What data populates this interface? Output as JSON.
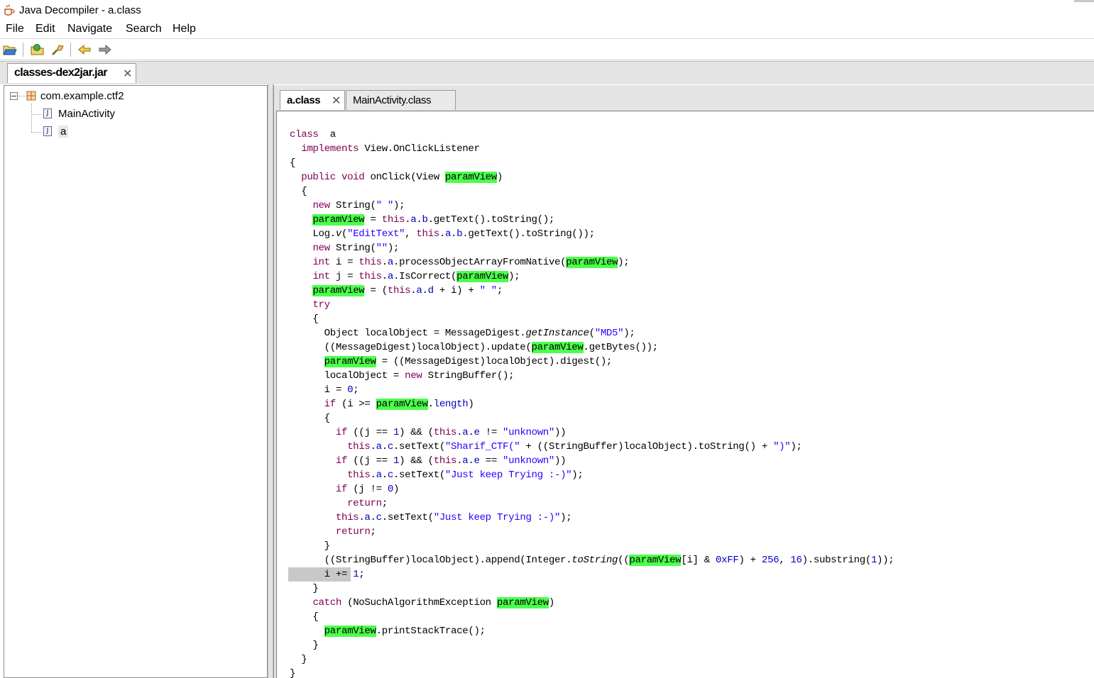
{
  "window": {
    "title": "Java Decompiler - a.class"
  },
  "menu": {
    "items": [
      "File",
      "Edit",
      "Navigate",
      "Search",
      "Help"
    ]
  },
  "toolbar": {
    "buttons": [
      "open-file-icon",
      "open-type-icon",
      "find-icon",
      "back-icon",
      "forward-icon"
    ]
  },
  "outer_tab": {
    "label": "classes-dex2jar.jar",
    "close": "✕"
  },
  "tree": {
    "package": "com.example.ctf2",
    "classes": [
      "MainActivity",
      "a"
    ],
    "selected": "a"
  },
  "inner_tabs": [
    {
      "label": "a.class",
      "close": "✕",
      "active": true
    },
    {
      "label": "MainActivity.class",
      "active": false
    }
  ],
  "colors": {
    "keyword": "#7f0055",
    "string": "#2a00ff",
    "field": "#0000c0",
    "highlight": "#4cff4c",
    "caret_line": "#c8c8c8"
  },
  "code_lines": [
    [
      [
        "kw",
        "class"
      ],
      [
        "",
        "  a"
      ]
    ],
    [
      [
        "",
        "  "
      ],
      [
        "kw",
        "implements"
      ],
      [
        "",
        " View.OnClickListener"
      ]
    ],
    [
      [
        "",
        "{"
      ]
    ],
    [
      [
        "",
        "  "
      ],
      [
        "kw",
        "public void"
      ],
      [
        "",
        " onClick(View "
      ],
      [
        "hv",
        "paramView"
      ],
      [
        "",
        ")"
      ]
    ],
    [
      [
        "",
        "  {"
      ]
    ],
    [
      [
        "",
        "    "
      ],
      [
        "kw",
        "new"
      ],
      [
        "",
        " String("
      ],
      [
        "str",
        "\" \""
      ],
      [
        "",
        ");"
      ]
    ],
    [
      [
        "",
        "    "
      ],
      [
        "hv",
        "paramView"
      ],
      [
        "",
        " = "
      ],
      [
        "kw",
        "this"
      ],
      [
        "",
        "."
      ],
      [
        "fld",
        "a"
      ],
      [
        "",
        "."
      ],
      [
        "fld",
        "b"
      ],
      [
        "",
        ".getText().toString();"
      ]
    ],
    [
      [
        "",
        "    Log."
      ],
      [
        "it",
        "v"
      ],
      [
        "",
        "("
      ],
      [
        "str",
        "\"EditText\""
      ],
      [
        "",
        ", "
      ],
      [
        "kw",
        "this"
      ],
      [
        "",
        "."
      ],
      [
        "fld",
        "a"
      ],
      [
        "",
        "."
      ],
      [
        "fld",
        "b"
      ],
      [
        "",
        ".getText().toString());"
      ]
    ],
    [
      [
        "",
        "    "
      ],
      [
        "kw",
        "new"
      ],
      [
        "",
        " String("
      ],
      [
        "str",
        "\"\""
      ],
      [
        "",
        ");"
      ]
    ],
    [
      [
        "",
        "    "
      ],
      [
        "kw",
        "int"
      ],
      [
        "",
        " i = "
      ],
      [
        "kw",
        "this"
      ],
      [
        "",
        "."
      ],
      [
        "fld",
        "a"
      ],
      [
        "",
        ".processObjectArrayFromNative("
      ],
      [
        "hv",
        "paramView"
      ],
      [
        "",
        ");"
      ]
    ],
    [
      [
        "",
        "    "
      ],
      [
        "kw",
        "int"
      ],
      [
        "",
        " j = "
      ],
      [
        "kw",
        "this"
      ],
      [
        "",
        "."
      ],
      [
        "fld",
        "a"
      ],
      [
        "",
        ".IsCorrect("
      ],
      [
        "hv",
        "paramView"
      ],
      [
        "",
        ");"
      ]
    ],
    [
      [
        "",
        "    "
      ],
      [
        "hv",
        "paramView"
      ],
      [
        "",
        " = ("
      ],
      [
        "kw",
        "this"
      ],
      [
        "",
        "."
      ],
      [
        "fld",
        "a"
      ],
      [
        "",
        "."
      ],
      [
        "fld",
        "d"
      ],
      [
        "",
        " + i) + "
      ],
      [
        "str",
        "\" \""
      ],
      [
        "",
        ";"
      ]
    ],
    [
      [
        "",
        "    "
      ],
      [
        "kw",
        "try"
      ]
    ],
    [
      [
        "",
        "    {"
      ]
    ],
    [
      [
        "",
        "      Object localObject = MessageDigest."
      ],
      [
        "it",
        "getInstance"
      ],
      [
        "",
        "("
      ],
      [
        "str",
        "\"MD5\""
      ],
      [
        "",
        ");"
      ]
    ],
    [
      [
        "",
        "      ((MessageDigest)localObject).update("
      ],
      [
        "hv",
        "paramView"
      ],
      [
        "",
        ".getBytes());"
      ]
    ],
    [
      [
        "",
        "      "
      ],
      [
        "hv",
        "paramView"
      ],
      [
        "",
        " = ((MessageDigest)localObject).digest();"
      ]
    ],
    [
      [
        "",
        "      localObject = "
      ],
      [
        "kw",
        "new"
      ],
      [
        "",
        " StringBuffer();"
      ]
    ],
    [
      [
        "",
        "      i = "
      ],
      [
        "num",
        "0"
      ],
      [
        "",
        ";"
      ]
    ],
    [
      [
        "",
        "      "
      ],
      [
        "kw",
        "if"
      ],
      [
        "",
        " (i >= "
      ],
      [
        "hv",
        "paramView"
      ],
      [
        "",
        "."
      ],
      [
        "fld",
        "length"
      ],
      [
        "",
        ")"
      ]
    ],
    [
      [
        "",
        "      {"
      ]
    ],
    [
      [
        "",
        "        "
      ],
      [
        "kw",
        "if"
      ],
      [
        "",
        " ((j == "
      ],
      [
        "num",
        "1"
      ],
      [
        "",
        ") && ("
      ],
      [
        "kw",
        "this"
      ],
      [
        "",
        "."
      ],
      [
        "fld",
        "a"
      ],
      [
        "",
        "."
      ],
      [
        "fld",
        "e"
      ],
      [
        "",
        " != "
      ],
      [
        "str",
        "\"unknown\""
      ],
      [
        "",
        "))"
      ]
    ],
    [
      [
        "",
        "          "
      ],
      [
        "kw",
        "this"
      ],
      [
        "",
        "."
      ],
      [
        "fld",
        "a"
      ],
      [
        "",
        "."
      ],
      [
        "fld",
        "c"
      ],
      [
        "",
        ".setText("
      ],
      [
        "str",
        "\"Sharif_CTF(\""
      ],
      [
        "",
        " + ((StringBuffer)localObject).toString() + "
      ],
      [
        "str",
        "\")\""
      ],
      [
        "",
        ");"
      ]
    ],
    [
      [
        "",
        "        "
      ],
      [
        "kw",
        "if"
      ],
      [
        "",
        " ((j == "
      ],
      [
        "num",
        "1"
      ],
      [
        "",
        ") && ("
      ],
      [
        "kw",
        "this"
      ],
      [
        "",
        "."
      ],
      [
        "fld",
        "a"
      ],
      [
        "",
        "."
      ],
      [
        "fld",
        "e"
      ],
      [
        "",
        " == "
      ],
      [
        "str",
        "\"unknown\""
      ],
      [
        "",
        "))"
      ]
    ],
    [
      [
        "",
        "          "
      ],
      [
        "kw",
        "this"
      ],
      [
        "",
        "."
      ],
      [
        "fld",
        "a"
      ],
      [
        "",
        "."
      ],
      [
        "fld",
        "c"
      ],
      [
        "",
        ".setText("
      ],
      [
        "str",
        "\"Just keep Trying :-)\""
      ],
      [
        "",
        ");"
      ]
    ],
    [
      [
        "",
        "        "
      ],
      [
        "kw",
        "if"
      ],
      [
        "",
        " (j != "
      ],
      [
        "num",
        "0"
      ],
      [
        "",
        ")"
      ]
    ],
    [
      [
        "",
        "          "
      ],
      [
        "kw",
        "return"
      ],
      [
        "",
        ";"
      ]
    ],
    [
      [
        "",
        "        "
      ],
      [
        "kw",
        "this"
      ],
      [
        "",
        "."
      ],
      [
        "fld",
        "a"
      ],
      [
        "",
        "."
      ],
      [
        "fld",
        "c"
      ],
      [
        "",
        ".setText("
      ],
      [
        "str",
        "\"Just keep Trying :-)\""
      ],
      [
        "",
        ");"
      ]
    ],
    [
      [
        "",
        "        "
      ],
      [
        "kw",
        "return"
      ],
      [
        "",
        ";"
      ]
    ],
    [
      [
        "",
        "      }"
      ]
    ],
    [
      [
        "",
        "      ((StringBuffer)localObject).append(Integer."
      ],
      [
        "it",
        "toString"
      ],
      [
        "",
        "(("
      ],
      [
        "hv",
        "paramView"
      ],
      [
        "",
        "[i] & "
      ],
      [
        "num",
        "0xFF"
      ],
      [
        "",
        ") + "
      ],
      [
        "num",
        "256"
      ],
      [
        "",
        ", "
      ],
      [
        "num",
        "16"
      ],
      [
        "",
        ").substring("
      ],
      [
        "num",
        "1"
      ],
      [
        "",
        "));"
      ]
    ],
    [
      [
        "",
        "      i += "
      ],
      [
        "num",
        "1"
      ],
      [
        "",
        ";"
      ]
    ],
    [
      [
        "",
        "    }"
      ]
    ],
    [
      [
        "",
        "    "
      ],
      [
        "kw",
        "catch"
      ],
      [
        "",
        " (NoSuchAlgorithmException "
      ],
      [
        "hv",
        "paramView"
      ],
      [
        "",
        ")"
      ]
    ],
    [
      [
        "",
        "    {"
      ]
    ],
    [
      [
        "",
        "      "
      ],
      [
        "hv",
        "paramView"
      ],
      [
        "",
        ".printStackTrace();"
      ]
    ],
    [
      [
        "",
        "    }"
      ]
    ],
    [
      [
        "",
        "  }"
      ]
    ],
    [
      [
        "",
        "}"
      ]
    ]
  ]
}
